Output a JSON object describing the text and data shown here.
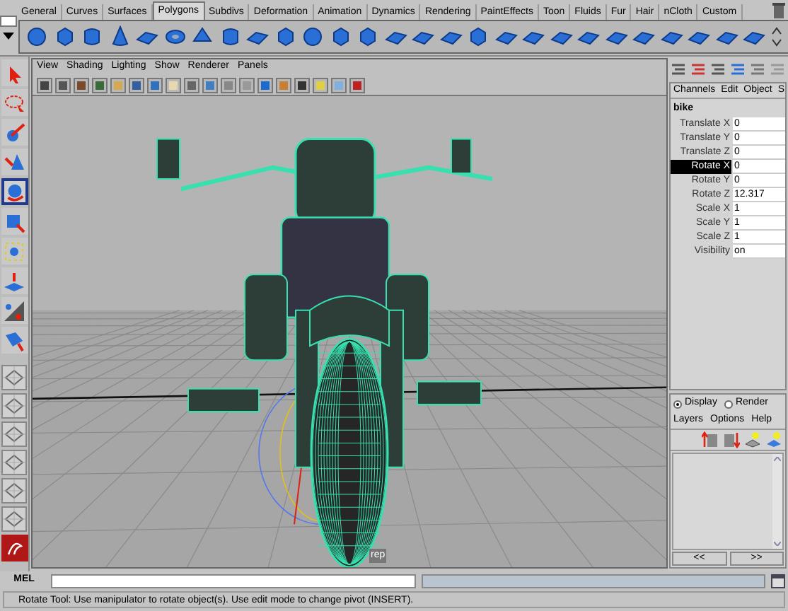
{
  "shelf": {
    "tabs": [
      {
        "label": "General",
        "selected": false
      },
      {
        "label": "Curves",
        "selected": false
      },
      {
        "label": "Surfaces",
        "selected": false
      },
      {
        "label": "Polygons",
        "selected": true
      },
      {
        "label": "Subdivs",
        "selected": false
      },
      {
        "label": "Deformation",
        "selected": false
      },
      {
        "label": "Animation",
        "selected": false
      },
      {
        "label": "Dynamics",
        "selected": false
      },
      {
        "label": "Rendering",
        "selected": false
      },
      {
        "label": "PaintEffects",
        "selected": false
      },
      {
        "label": "Toon",
        "selected": false
      },
      {
        "label": "Fluids",
        "selected": false
      },
      {
        "label": "Fur",
        "selected": false
      },
      {
        "label": "Hair",
        "selected": false
      },
      {
        "label": "nCloth",
        "selected": false
      },
      {
        "label": "Custom",
        "selected": false
      }
    ]
  },
  "toolbox": {
    "tools": [
      {
        "kind": "select",
        "selected": false
      },
      {
        "kind": "lasso",
        "selected": false
      },
      {
        "kind": "paint",
        "selected": false
      },
      {
        "kind": "move",
        "selected": false
      },
      {
        "kind": "rotate",
        "selected": true
      },
      {
        "kind": "scale",
        "selected": false
      },
      {
        "kind": "universal",
        "selected": false
      },
      {
        "kind": "soft",
        "selected": false
      },
      {
        "kind": "show",
        "selected": false
      },
      {
        "kind": "last",
        "selected": false
      }
    ]
  },
  "viewport": {
    "menu": [
      "View",
      "Shading",
      "Lighting",
      "Show",
      "Renderer",
      "Panels"
    ],
    "camera_label": "rep"
  },
  "channel_box": {
    "menu": [
      "Channels",
      "Edit",
      "Object",
      "S"
    ],
    "object": "bike",
    "attributes": [
      {
        "name": "Translate X",
        "value": "0",
        "selected": false
      },
      {
        "name": "Translate Y",
        "value": "0",
        "selected": false
      },
      {
        "name": "Translate Z",
        "value": "0",
        "selected": false
      },
      {
        "name": "Rotate X",
        "value": "0",
        "selected": true
      },
      {
        "name": "Rotate Y",
        "value": "0",
        "selected": false
      },
      {
        "name": "Rotate Z",
        "value": "12.317",
        "selected": false
      },
      {
        "name": "Scale X",
        "value": "1",
        "selected": false
      },
      {
        "name": "Scale Y",
        "value": "1",
        "selected": false
      },
      {
        "name": "Scale Z",
        "value": "1",
        "selected": false
      },
      {
        "name": "Visibility",
        "value": "on",
        "selected": false
      }
    ]
  },
  "layer_editor": {
    "modes": [
      {
        "label": "Display",
        "selected": true
      },
      {
        "label": "Render",
        "selected": false
      }
    ],
    "menu": [
      "Layers",
      "Options",
      "Help"
    ],
    "scroll_buttons": [
      "<<",
      ">>"
    ]
  },
  "command_line": {
    "label": "MEL"
  },
  "help_line": "Rotate Tool: Use manipulator to rotate object(s). Use edit mode to change pivot (INSERT)."
}
